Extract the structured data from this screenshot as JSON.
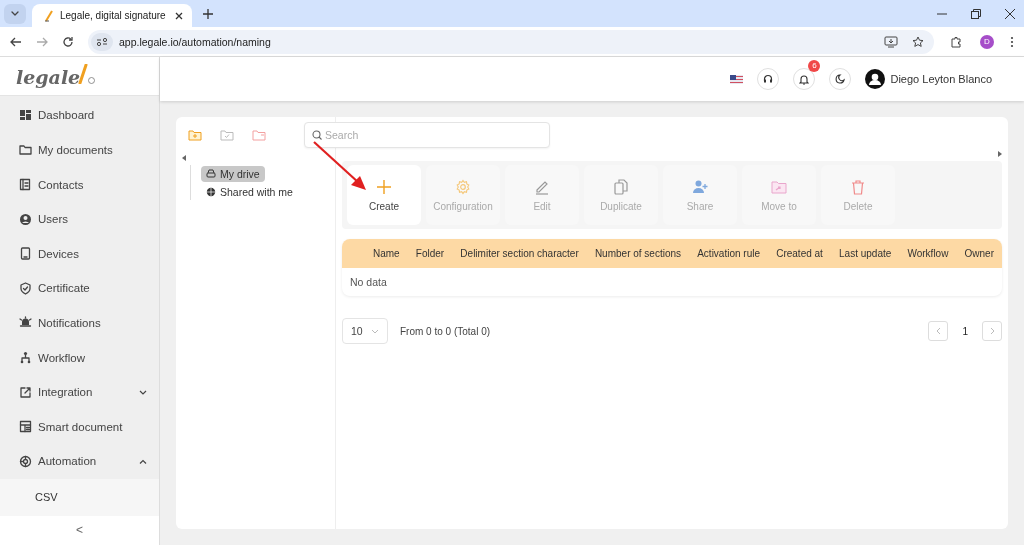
{
  "browser": {
    "tab_title": "Legale, digital signature",
    "url": "app.legale.io/automation/naming",
    "profile_initial": "D"
  },
  "logo": {
    "text": "legale"
  },
  "header": {
    "notification_count": "6",
    "user_name": "Diego Leyton Blanco"
  },
  "sidebar": {
    "items": [
      {
        "label": "Dashboard"
      },
      {
        "label": "My documents"
      },
      {
        "label": "Contacts"
      },
      {
        "label": "Users"
      },
      {
        "label": "Devices"
      },
      {
        "label": "Certificate"
      },
      {
        "label": "Notifications"
      },
      {
        "label": "Workflow"
      },
      {
        "label": "Integration",
        "expanded": false
      },
      {
        "label": "Smart document"
      },
      {
        "label": "Automation",
        "expanded": true,
        "children": [
          {
            "label": "CSV",
            "selected": true
          }
        ]
      }
    ],
    "collapse_label": "<"
  },
  "search": {
    "placeholder": "Search"
  },
  "tree": [
    {
      "label": "My drive",
      "selected": true
    },
    {
      "label": "Shared with me",
      "selected": false
    }
  ],
  "toolbar": [
    {
      "label": "Create",
      "disabled": false
    },
    {
      "label": "Configuration",
      "disabled": true
    },
    {
      "label": "Edit",
      "disabled": true
    },
    {
      "label": "Duplicate",
      "disabled": true
    },
    {
      "label": "Share",
      "disabled": true
    },
    {
      "label": "Move to",
      "disabled": true
    },
    {
      "label": "Delete",
      "disabled": true
    }
  ],
  "table": {
    "columns": [
      "Name",
      "Folder",
      "Delimiter section character",
      "Number of sections",
      "Activation rule",
      "Created at",
      "Last update",
      "Workflow",
      "Owner"
    ],
    "empty_text": "No data"
  },
  "pagination": {
    "page_size": "10",
    "summary": "From 0 to 0 (Total 0)",
    "pages": [
      {
        "label": "1",
        "selected": true
      }
    ]
  }
}
